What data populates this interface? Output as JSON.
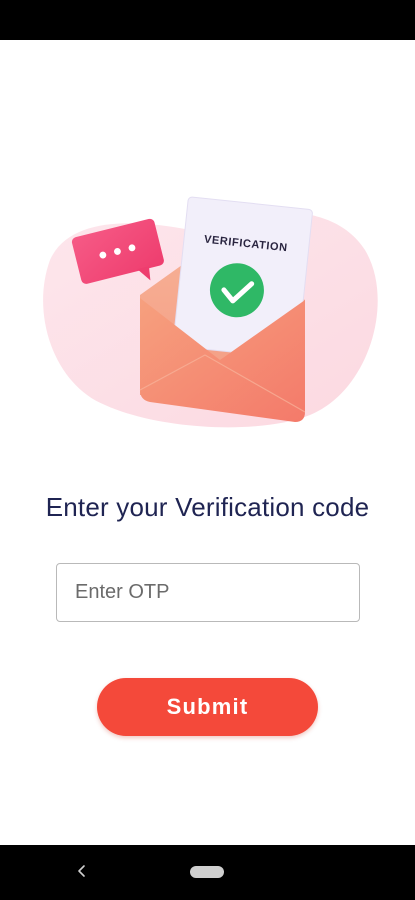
{
  "illustration": {
    "doc_label": "VERIFICATION",
    "icons": [
      "chat-bubble-icon",
      "envelope-icon",
      "checkmark-icon"
    ]
  },
  "heading": "Enter your Verification code",
  "otp_input": {
    "value": "",
    "placeholder": "Enter OTP"
  },
  "submit_label": "Submit",
  "colors": {
    "accent": "#f4493a",
    "heading": "#1f2452",
    "check_green": "#2fb866",
    "envelope": "#f48a6a",
    "bubble": "#f0457a"
  },
  "nav": {
    "back_icon": "chevron-left-icon",
    "home_icon": "home-pill-icon"
  }
}
